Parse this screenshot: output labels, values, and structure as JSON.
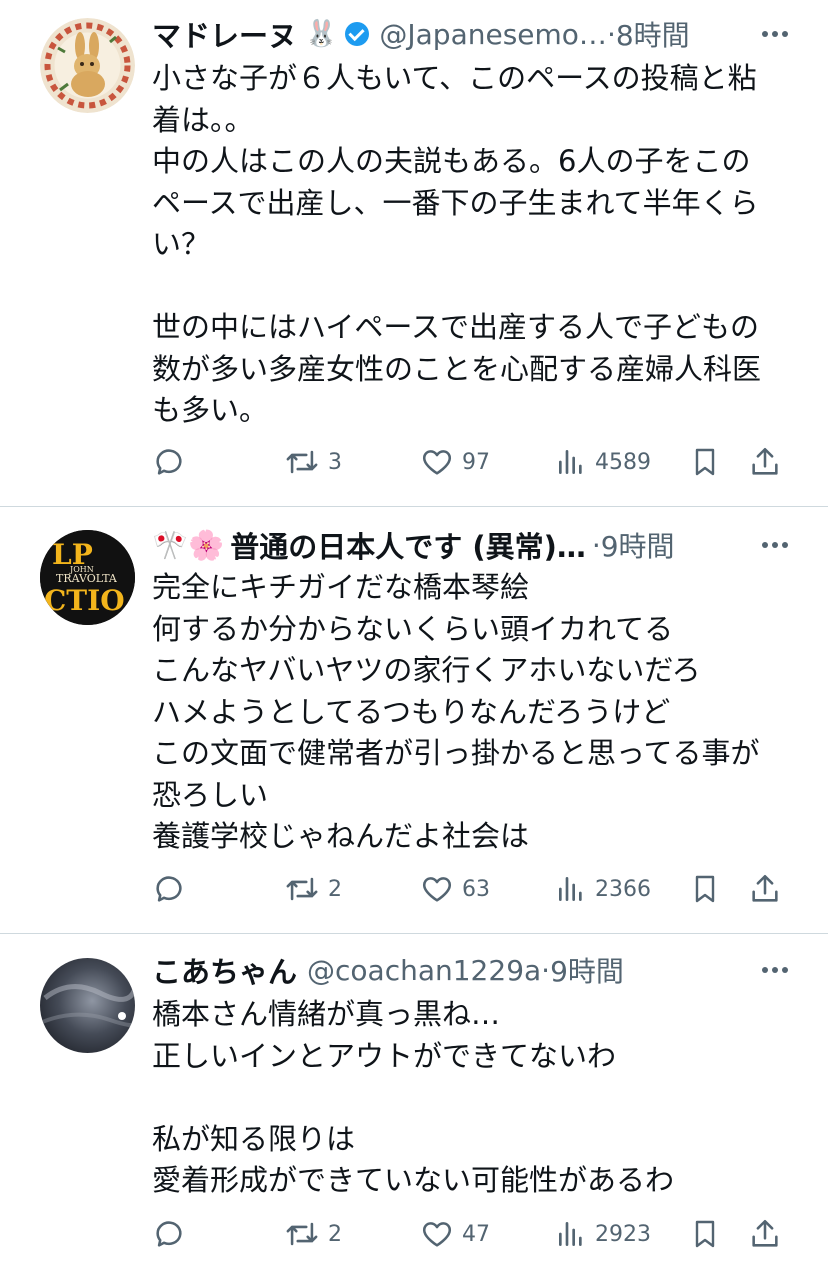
{
  "posts": [
    {
      "name": "マドレーヌ",
      "name_emoji": "🐰",
      "verified": true,
      "prefix_emoji": "",
      "handle": "@Japanesemo…",
      "time": "8時間",
      "lines": [
        "小さな子が６人もいて、このペースの投稿と粘",
        "着は。。",
        "中の人はこの人の夫説もある。6人の子をこの",
        "ペースで出産し、一番下の子生まれて半年くら",
        "い？",
        "",
        "世の中にはハイペースで出産する人で子どもの",
        "数が多い多産女性のことを心配する産婦人科医",
        "も多い。"
      ],
      "retweets": "3",
      "likes": "97",
      "views": "4589"
    },
    {
      "name": "普通の日本人です (異常)…",
      "name_emoji": "",
      "verified": false,
      "prefix_emoji": "🎌🌸",
      "handle": "",
      "time": "9時間",
      "lines": [
        "完全にキチガイだな橋本琴絵",
        "何するか分からないくらい頭イカれてる",
        "こんなヤバいヤツの家行くアホいないだろ",
        "ハメようとしてるつもりなんだろうけど",
        "この文面で健常者が引っ掛かると思ってる事が",
        "恐ろしい",
        "養護学校じゃねんだよ社会は"
      ],
      "retweets": "2",
      "likes": "63",
      "views": "2366"
    },
    {
      "name": "こあちゃん",
      "name_emoji": "",
      "verified": false,
      "prefix_emoji": "",
      "handle": "@coachan1229a",
      "time": "9時間",
      "lines": [
        "橋本さん情緒が真っ黒ね…",
        "正しいインとアウトができてないわ",
        "",
        "私が知る限りは",
        "愛着形成ができていない可能性があるわ"
      ],
      "retweets": "2",
      "likes": "47",
      "views": "2923"
    }
  ],
  "avatar2_text": [
    "LP",
    "JOHN",
    "TRAVOLTA",
    "CTIO"
  ],
  "colors": {
    "text": "#0f1419",
    "secondary": "#536471",
    "verified": "#1d9bf0",
    "divider": "#cfd9de"
  },
  "icons": [
    "reply-icon",
    "retweet-icon",
    "like-icon",
    "views-icon",
    "bookmark-icon",
    "share-icon",
    "more-icon"
  ]
}
